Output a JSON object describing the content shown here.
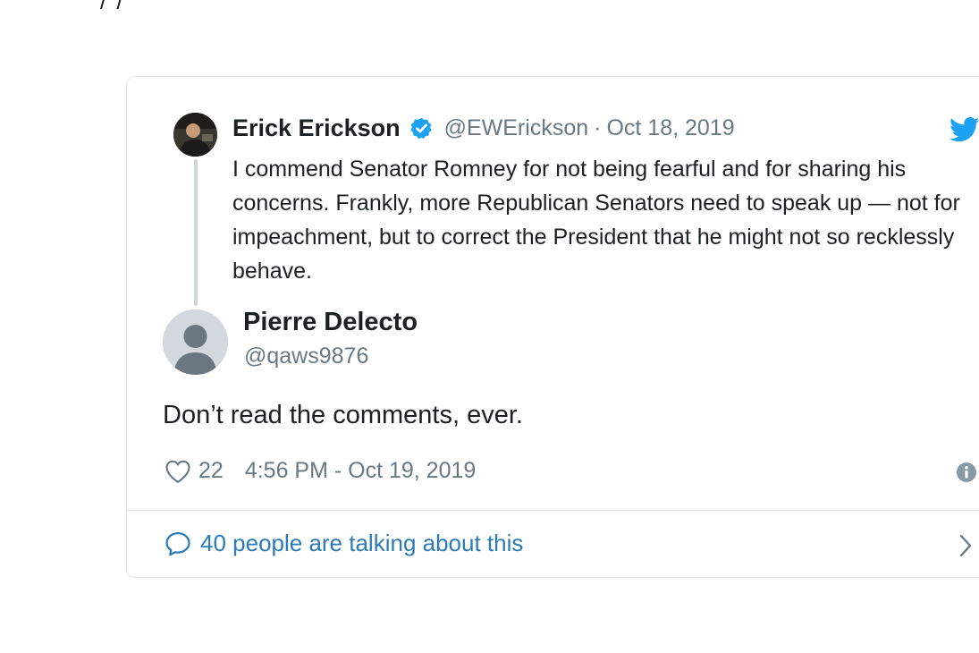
{
  "top_fragment": "/ /",
  "parent_tweet": {
    "name": "Erick Erickson",
    "handle": "@EWErickson",
    "separator": "·",
    "date": "Oct 18, 2019",
    "text": "I commend Senator Romney for not being fearful and for sharing his concerns.  Frankly, more Republican Senators need to speak up — not for impeachment, but to correct the President that he might not so recklessly behave.",
    "verified": true
  },
  "tweet": {
    "name": "Pierre Delecto",
    "handle": "@qaws9876",
    "text": "Don’t read the comments, ever.",
    "likes": "22",
    "timestamp": "4:56 PM - Oct 19, 2019"
  },
  "footer": {
    "conversation": "40 people are talking about this"
  },
  "icons": {
    "verified": "verified-badge-icon",
    "brand": "twitter-bird-icon",
    "like": "heart-icon",
    "info": "info-icon",
    "reply": "speech-bubble-icon",
    "expand": "chevron-right-icon"
  },
  "colors": {
    "twitter_blue": "#1da1f2",
    "link_blue": "#2b7bb9",
    "secondary_text": "#697882",
    "border": "#e1e8ed"
  }
}
